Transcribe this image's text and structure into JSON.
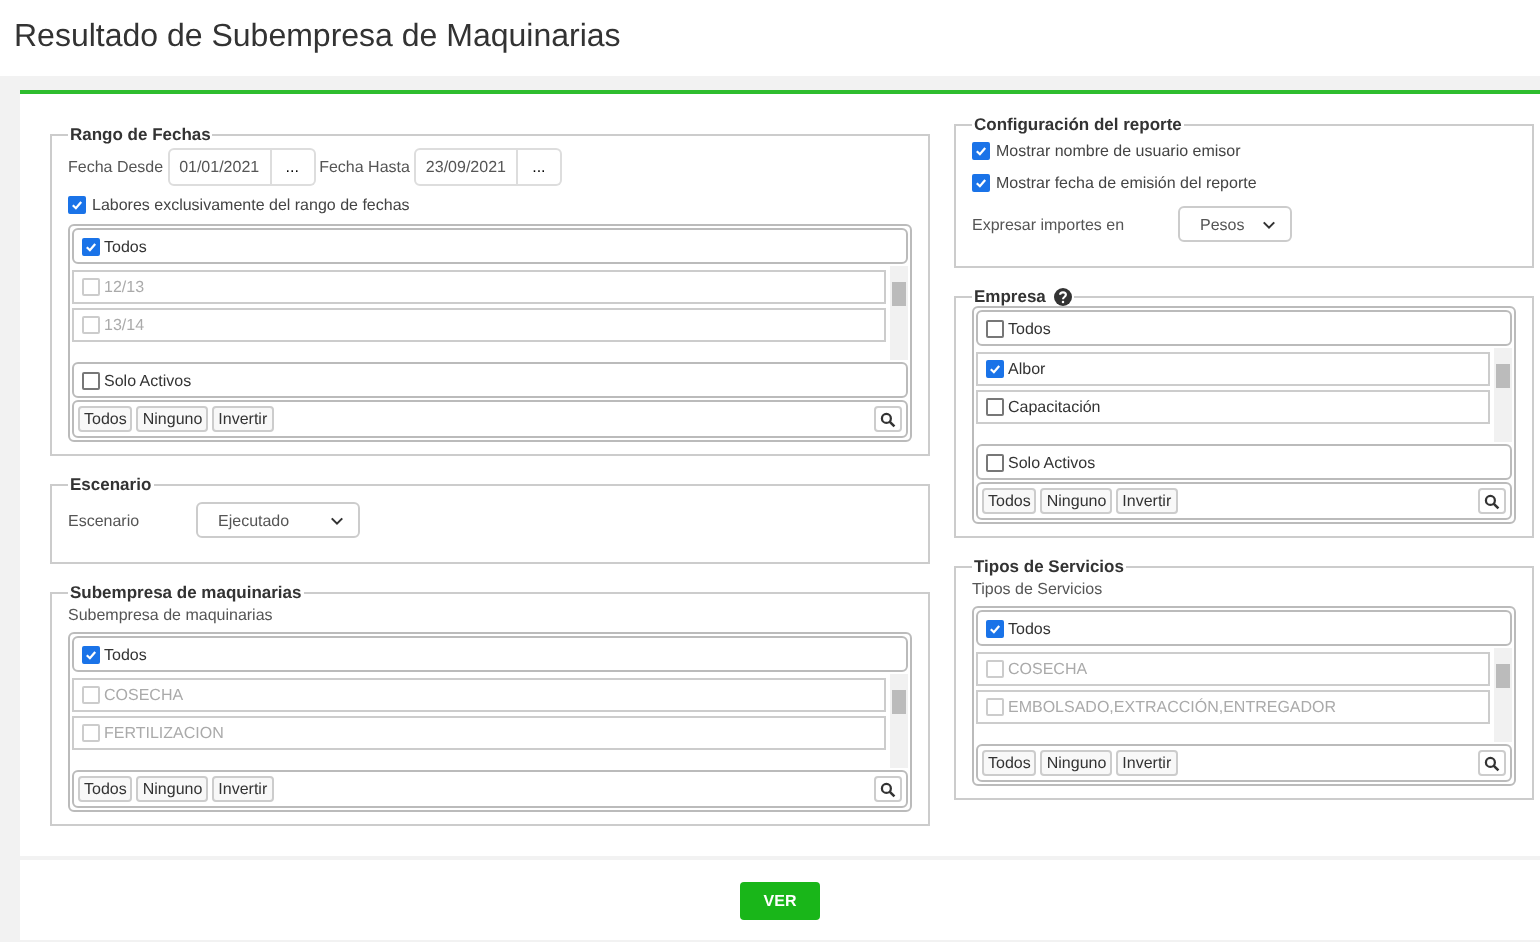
{
  "page_title": "Resultado de Subempresa de Maquinarias",
  "left_column": [
    {
      "kind": "dates",
      "title": "Rango de Fechas",
      "from_label": "Fecha Desde",
      "from_value": "01/01/2021",
      "to_label": "Fecha Hasta",
      "to_value": "23/09/2021",
      "picker": "...",
      "exclusive": {
        "label": "Labores exclusivamente del rango de fechas",
        "checked": true
      },
      "select": {
        "all": {
          "label": "Todos",
          "checked": true
        },
        "items": [
          {
            "label": "12/13",
            "checked": false,
            "disabled": true
          },
          {
            "label": "13/14",
            "checked": false,
            "disabled": true
          }
        ],
        "only_active": {
          "label": "Solo Activos",
          "checked": false
        },
        "buttons": [
          "Todos",
          "Ninguno",
          "Invertir"
        ]
      }
    },
    {
      "kind": "scenario",
      "title": "Escenario",
      "field_label": "Escenario",
      "value": "Ejecutado"
    },
    {
      "kind": "select",
      "title": "Subempresa de maquinarias",
      "help": false,
      "select": {
        "label": "Subempresa de maquinarias",
        "all": {
          "label": "Todos",
          "checked": true
        },
        "items": [
          {
            "label": "COSECHA",
            "checked": false,
            "disabled": true
          },
          {
            "label": "FERTILIZACION",
            "checked": false,
            "disabled": true
          }
        ],
        "buttons": [
          "Todos",
          "Ninguno",
          "Invertir"
        ]
      }
    }
  ],
  "right_column": [
    {
      "kind": "config",
      "title": "Configuración del reporte",
      "options": [
        {
          "label": "Mostrar nombre de usuario emisor",
          "checked": true
        },
        {
          "label": "Mostrar fecha de emisión del reporte",
          "checked": true
        }
      ],
      "currency_label": "Expresar importes en",
      "currency_value": "Pesos"
    },
    {
      "kind": "select",
      "title": "Empresa",
      "help": true,
      "select": {
        "all": {
          "label": "Todos",
          "checked": false
        },
        "items": [
          {
            "label": "Albor",
            "checked": true,
            "disabled": false
          },
          {
            "label": "Capacitación",
            "checked": false,
            "disabled": false
          }
        ],
        "only_active": {
          "label": "Solo Activos",
          "checked": false
        },
        "buttons": [
          "Todos",
          "Ninguno",
          "Invertir"
        ]
      }
    },
    {
      "kind": "select",
      "title": "Tipos de Servicios",
      "help": false,
      "select": {
        "label": "Tipos de Servicios",
        "all": {
          "label": "Todos",
          "checked": true
        },
        "items": [
          {
            "label": "COSECHA",
            "checked": false,
            "disabled": true
          },
          {
            "label": "EMBOLSADO,EXTRACCIÓN,ENTREGADOR",
            "checked": false,
            "disabled": true
          }
        ],
        "buttons": [
          "Todos",
          "Ninguno",
          "Invertir"
        ]
      }
    }
  ],
  "submit": "VER"
}
